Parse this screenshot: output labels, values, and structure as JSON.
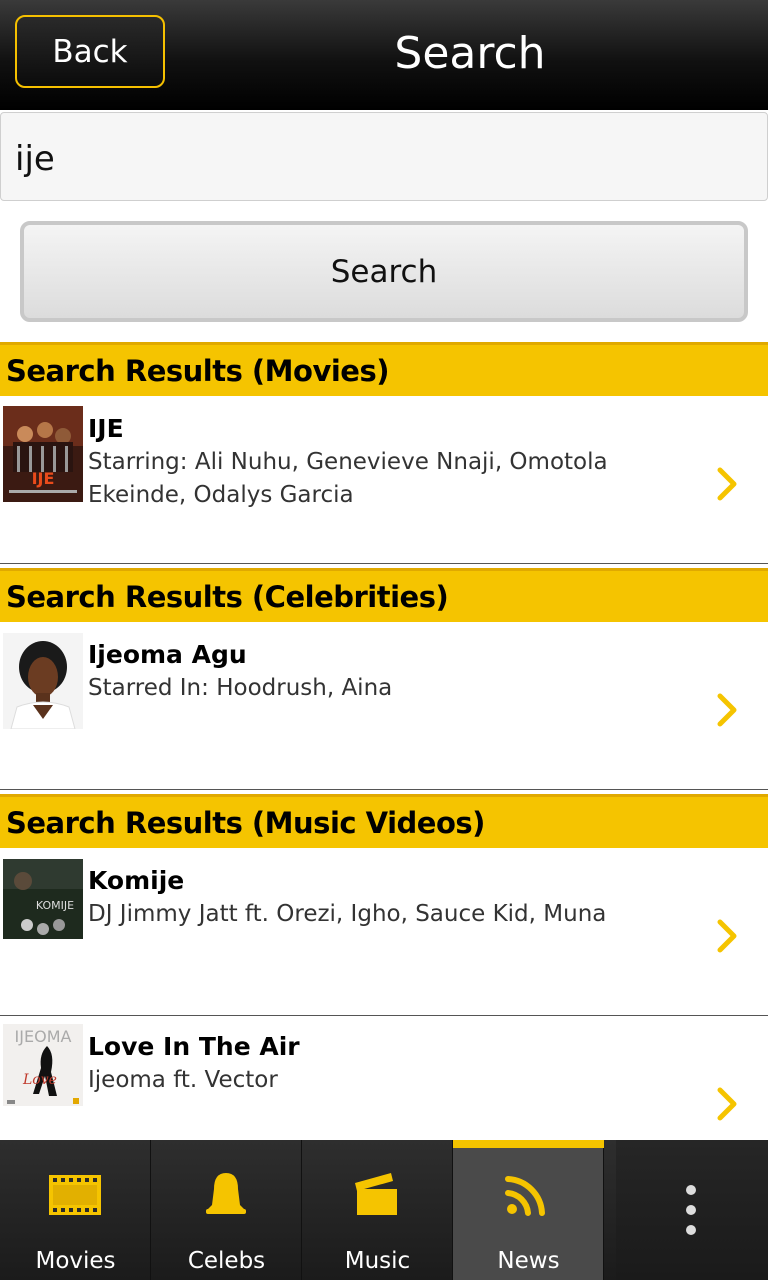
{
  "header": {
    "back_label": "Back",
    "title": "Search"
  },
  "search": {
    "query": "ije",
    "button_label": "Search"
  },
  "sections": {
    "movies": {
      "title": "Search Results (Movies)",
      "items": [
        {
          "title": "IJE",
          "subtitle": "Starring: Ali Nuhu, Genevieve Nnaji, Omotola Ekeinde, Odalys Garcia"
        }
      ]
    },
    "celebrities": {
      "title": "Search Results (Celebrities)",
      "items": [
        {
          "title": "Ijeoma Agu",
          "subtitle": "Starred In: Hoodrush, Aina"
        }
      ]
    },
    "music_videos": {
      "title": "Search Results (Music Videos)",
      "items": [
        {
          "title": "Komije",
          "subtitle": "DJ Jimmy Jatt ft. Orezi, Igho, Sauce Kid, Muna"
        },
        {
          "title": "Love In The Air",
          "subtitle": "Ijeoma ft. Vector"
        }
      ]
    }
  },
  "tabs": [
    {
      "label": "Movies",
      "icon": "film-strip-icon"
    },
    {
      "label": "Celebs",
      "icon": "bell-icon"
    },
    {
      "label": "Music",
      "icon": "clapperboard-icon"
    },
    {
      "label": "News",
      "icon": "rss-icon",
      "active": true
    }
  ],
  "colors": {
    "accent": "#f5c400",
    "header_bg": "#000000",
    "tabbar_bg": "#222222"
  }
}
